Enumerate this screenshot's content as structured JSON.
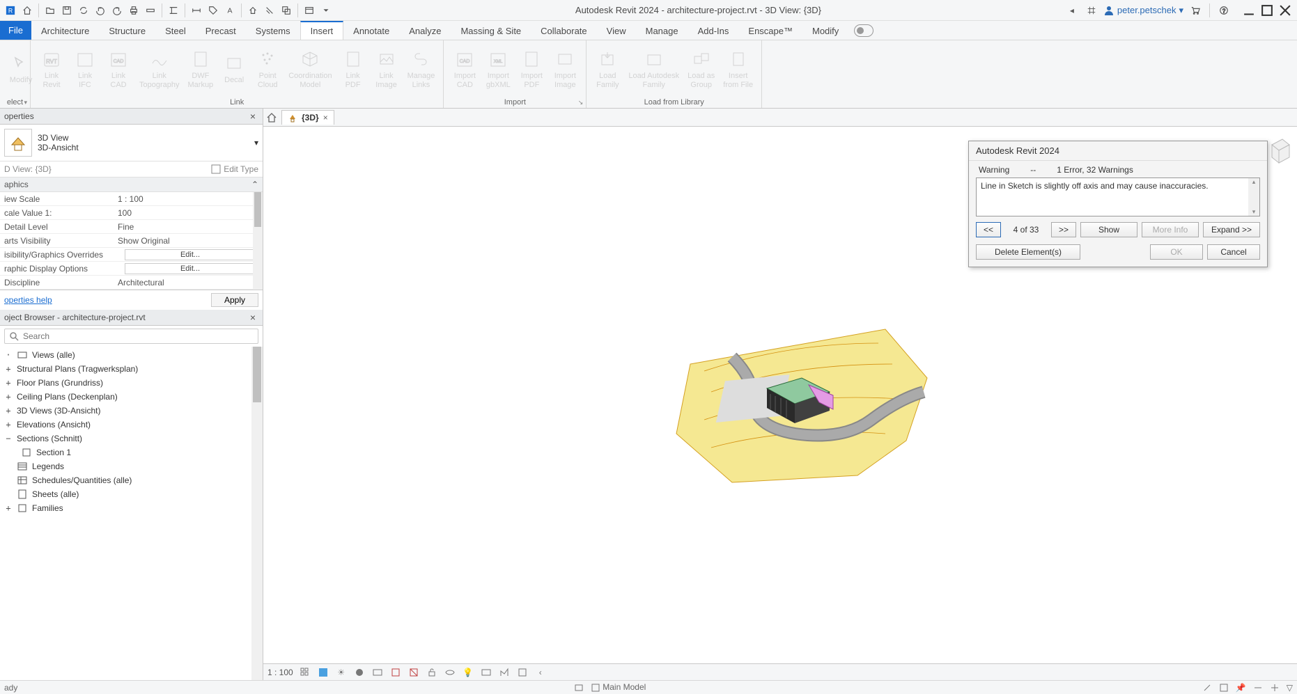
{
  "titlebar": {
    "title": "Autodesk Revit 2024 - architecture-project.rvt - 3D View: {3D}",
    "user": "peter.petschek"
  },
  "menu": {
    "file": "File",
    "tabs": [
      "Architecture",
      "Structure",
      "Steel",
      "Precast",
      "Systems",
      "Insert",
      "Annotate",
      "Analyze",
      "Massing & Site",
      "Collaborate",
      "View",
      "Manage",
      "Add-Ins",
      "Enscape™",
      "Modify"
    ],
    "active": "Insert"
  },
  "ribbon": {
    "select_panel": "elect",
    "modify": "Modify",
    "link_panel": "Link",
    "import_panel": "Import",
    "library_panel": "Load from Library",
    "buttons": {
      "link_revit": "Link\nRevit",
      "link_ifc": "Link\nIFC",
      "link_cad": "Link\nCAD",
      "link_topo": "Link\nTopography",
      "dwf_markup": "DWF\nMarkup",
      "decal": "Decal",
      "point_cloud": "Point\nCloud",
      "coord_model": "Coordination\nModel",
      "link_pdf": "Link\nPDF",
      "link_image": "Link\nImage",
      "manage_links": "Manage\nLinks",
      "import_cad": "Import\nCAD",
      "import_gbxml": "Import\ngbXML",
      "import_pdf": "Import\nPDF",
      "import_image": "Import\nImage",
      "load_family": "Load\nFamily",
      "load_autodesk": "Load Autodesk\nFamily",
      "load_group": "Load as\nGroup",
      "insert_file": "Insert\nfrom File"
    }
  },
  "properties": {
    "panel_title": "operties",
    "type_line1": "3D View",
    "type_line2": "3D-Ansicht",
    "instance_label": "D View: {3D}",
    "edit_type": "Edit Type",
    "group_graphics": "aphics",
    "rows": {
      "view_scale_k": "iew Scale",
      "view_scale_v": "1 : 100",
      "scale_value_k": "cale Value    1:",
      "scale_value_v": "100",
      "detail_k": "Detail Level",
      "detail_v": "Fine",
      "parts_k": "arts Visibility",
      "parts_v": "Show Original",
      "vis_k": "isibility/Graphics Overrides",
      "vis_v": "Edit...",
      "gfx_k": "raphic Display Options",
      "gfx_v": "Edit...",
      "disc_k": "Discipline",
      "disc_v": "Architectural"
    },
    "help": "operties help",
    "apply": "Apply"
  },
  "browser": {
    "panel_title": "oject Browser - architecture-project.rvt",
    "search_placeholder": "Search",
    "nodes": {
      "views": "Views (alle)",
      "structural": "Structural Plans (Tragwerksplan)",
      "floor": "Floor Plans (Grundriss)",
      "ceiling": "Ceiling Plans (Deckenplan)",
      "three_d": "3D Views (3D-Ansicht)",
      "elevations": "Elevations (Ansicht)",
      "sections": "Sections (Schnitt)",
      "section1": "Section 1",
      "legends": "Legends",
      "schedules": "Schedules/Quantities (alle)",
      "sheets": "Sheets (alle)",
      "families": "Families"
    }
  },
  "viewtab": {
    "name": "{3D}"
  },
  "dialog": {
    "title": "Autodesk Revit 2024",
    "warning_label": "Warning",
    "dash": "--",
    "count_label": "1 Error, 32 Warnings",
    "message": "Line in Sketch is slightly off axis and may cause inaccuracies.",
    "prev": "<<",
    "page": "4 of 33",
    "next": ">>",
    "show": "Show",
    "more_info": "More Info",
    "expand": "Expand >>",
    "delete": "Delete Element(s)",
    "ok": "OK",
    "cancel": "Cancel"
  },
  "viewbar": {
    "scale": "1 : 100"
  },
  "status": {
    "ready": "ady",
    "main_model": "Main Model"
  }
}
